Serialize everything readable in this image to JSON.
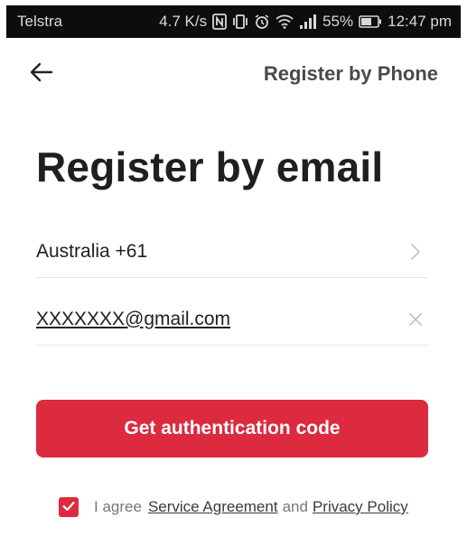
{
  "status_bar": {
    "carrier": "Telstra",
    "speed": "4.7 K/s",
    "battery": "55%",
    "time": "12:47 pm",
    "icons": [
      "nfc-icon",
      "vibrate-icon",
      "alarm-icon",
      "wifi-icon",
      "signal-icon",
      "battery-icon"
    ]
  },
  "nav": {
    "back_icon": "arrow-left-icon",
    "register_phone_label": "Register by Phone"
  },
  "page": {
    "title": "Register by email"
  },
  "form": {
    "country_value": "Australia +61",
    "country_icon": "chevron-right-icon",
    "email_value": "XXXXXXX@gmail.com",
    "clear_icon": "close-icon"
  },
  "actions": {
    "get_code_label": "Get authentication code"
  },
  "agreement": {
    "checked": true,
    "prefix": "I agree",
    "service_link": "Service Agreement",
    "conjunction": "and",
    "privacy_link": "Privacy Policy"
  },
  "colors": {
    "accent": "#dc2a3e",
    "status_bar_bg": "#0d0d0d",
    "cursor": "#e06a00"
  }
}
